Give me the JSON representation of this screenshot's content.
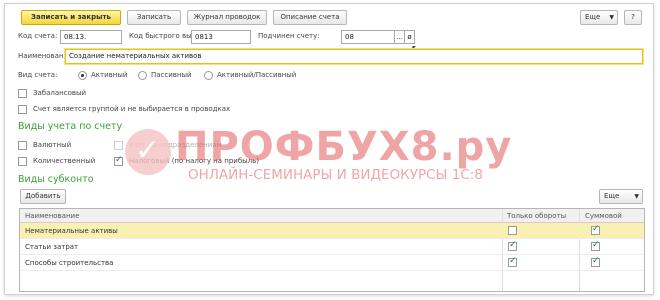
{
  "toolbar": {
    "save_close": "Записать и закрыть",
    "save": "Записать",
    "journal": "Журнал проводок",
    "description": "Описание счета",
    "more": "Еще",
    "help": "?"
  },
  "fields": {
    "code_label": "Код счета:",
    "code_value": "08.13.",
    "quick_label": "Код быстрого выбора:",
    "quick_value": "0813",
    "parent_label": "Подчинен счету:",
    "parent_value": "08",
    "name_label": "Наименование:",
    "name_value": "Создание нематериальных активов"
  },
  "account_type": {
    "label": "Вид счета:",
    "options": [
      "Активный",
      "Пассивный",
      "Активный/Пассивный"
    ],
    "selected": "Активный"
  },
  "checkboxes": {
    "off_balance": "Забалансовый",
    "is_group": "Счет является группой и не выбирается в проводках"
  },
  "accounting_types": {
    "title": "Виды учета по счету",
    "currency": "Валютный",
    "quantity": "Количественный",
    "subdivisions": "Учет по подразделениям",
    "tax": "Налоговый (по налогу на прибыль)"
  },
  "subconto": {
    "title": "Виды субконто",
    "add_button": "Добавить",
    "more": "Еще",
    "columns": [
      "Наименование",
      "Только обороты",
      "Суммовой"
    ],
    "rows": [
      {
        "name": "Нематериальные активы",
        "turnover_only": false,
        "sum": true
      },
      {
        "name": "Статьи затрат",
        "turnover_only": true,
        "sum": true
      },
      {
        "name": "Способы строительства",
        "turnover_only": true,
        "sum": true
      }
    ]
  },
  "watermark": {
    "brand": "ПРОФБУХ8.ру",
    "tagline": "ОНЛАЙН-СЕМИНАРЫ И ВИДЕОКУРСЫ 1С:8"
  },
  "colors": {
    "primary_button": "#f2d73a",
    "section_title": "#3d9f3a",
    "selected_row": "#fbf0b3",
    "watermark": "#e35d5d"
  }
}
